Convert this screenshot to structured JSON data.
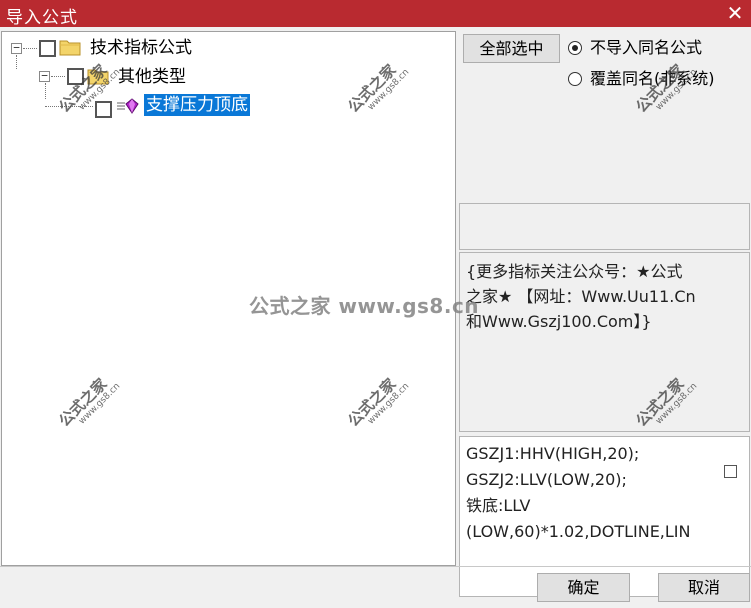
{
  "window": {
    "title": "导入公式",
    "close_glyph": "✕"
  },
  "tree": {
    "root": {
      "label": "技术指标公式",
      "expander": "−",
      "icon": "folder-icon"
    },
    "child": {
      "label": "其他类型",
      "expander": "−",
      "icon": "folder-icon"
    },
    "leaf": {
      "label": "支撑压力顶底",
      "icon": "formula-gem-icon",
      "selected": true
    }
  },
  "options": {
    "select_all_label": "全部选中",
    "radio_no_import_same_name": "不导入同名公式",
    "radio_overwrite_same_name": "覆盖同名(非系统)",
    "selected_radio": "no_import"
  },
  "description": {
    "lines": [
      "{更多指标关注公众号：★公式",
      "之家★ 【网址：Www.Uu11.Cn",
      "和Www.Gszj100.Com】}"
    ]
  },
  "code": {
    "lines": [
      "GSZJ1:HHV(HIGH,20);",
      "GSZJ2:LLV(LOW,20);",
      "铁底:LLV",
      "(LOW,60)*1.02,DOTLINE,LIN"
    ]
  },
  "buttons": {
    "ok_label": "确定",
    "cancel_label": "取消"
  },
  "watermark": {
    "main": "公式之家 www.gs8.cn",
    "stamp_cn": "公式之家",
    "stamp_url": "www.gs8.cn"
  },
  "colors": {
    "titlebar": "#b92a30",
    "selection": "#0a78d7"
  }
}
